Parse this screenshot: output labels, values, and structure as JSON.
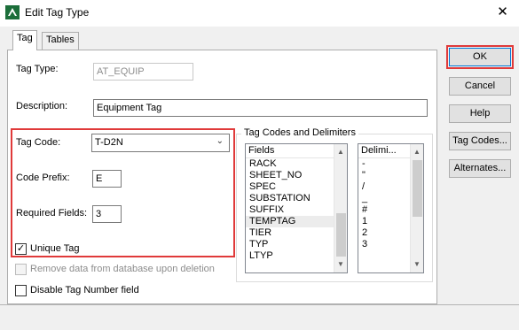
{
  "window": {
    "title": "Edit Tag Type",
    "close_glyph": "✕",
    "icon": "app-icon"
  },
  "tabs": [
    {
      "label": "Tag"
    },
    {
      "label": "Tables"
    }
  ],
  "form": {
    "tag_type_label": "Tag Type:",
    "tag_type_value": "AT_EQUIP",
    "description_label": "Description:",
    "description_value": "Equipment Tag",
    "tag_code_label": "Tag Code:",
    "tag_code_value": "T-D2N",
    "code_prefix_label": "Code Prefix:",
    "code_prefix_value": "E",
    "required_fields_label": "Required Fields:",
    "required_fields_value": "3",
    "unique_tag_label": "Unique Tag",
    "unique_tag_checked": true,
    "remove_data_label": "Remove data from database upon deletion",
    "disable_tag_number_label": "Disable Tag Number field"
  },
  "group": {
    "title": "Tag Codes and Delimiters",
    "fields_header": "Fields",
    "delims_header": "Delimi...",
    "fields": [
      "RACK",
      "SHEET_NO",
      "SPEC",
      "SUBSTATION",
      "SUFFIX",
      "TEMPTAG",
      "TIER",
      "TYP",
      "LTYP"
    ],
    "selected_field": "TEMPTAG",
    "delimiters": [
      "-",
      "\"",
      "/",
      "_",
      "#",
      "1",
      "2",
      "3"
    ]
  },
  "buttons": {
    "ok": "OK",
    "cancel": "Cancel",
    "help": "Help",
    "tag_codes": "Tag Codes...",
    "alternates": "Alternates..."
  },
  "colors": {
    "highlight": "#e03a3a",
    "focus": "#0078d7"
  }
}
